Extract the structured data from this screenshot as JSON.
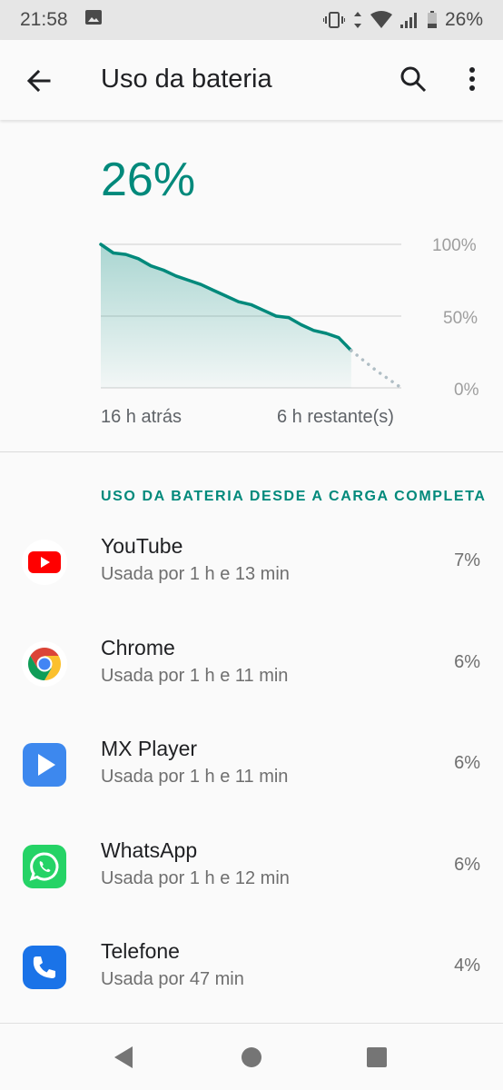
{
  "status_bar": {
    "time": "21:58",
    "battery_text": "26%",
    "icons": [
      "image-icon",
      "vibrate-icon",
      "data-arrows-icon",
      "wifi-icon",
      "signal-icon",
      "battery-icon"
    ]
  },
  "app_bar": {
    "title": "Uso da bateria",
    "back_icon": "arrow-back-icon",
    "search_icon": "search-icon",
    "more_icon": "more-vert-icon"
  },
  "battery": {
    "level": "26%",
    "accent_color": "#00897b"
  },
  "chart_data": {
    "type": "area",
    "y_tick_labels": [
      "100%",
      "50%",
      "0%"
    ],
    "x_labels": {
      "start": "16 h atrás",
      "end": "6 h restante(s)"
    },
    "ylim": [
      0,
      100
    ],
    "series": [
      {
        "values": [
          100,
          94,
          93,
          90,
          85,
          82,
          78,
          75,
          72,
          68,
          64,
          60,
          58,
          54,
          50,
          49,
          44,
          40,
          38,
          35,
          26
        ],
        "style": "solid"
      },
      {
        "values": [
          26,
          19,
          12,
          6,
          0
        ],
        "style": "dotted"
      }
    ]
  },
  "section": {
    "title": "USO DA BATERIA DESDE A CARGA COMPLETA"
  },
  "apps": [
    {
      "name": "YouTube",
      "usage": "Usada por 1 h e 13 min",
      "percent": "7%",
      "icon": "youtube-icon"
    },
    {
      "name": "Chrome",
      "usage": "Usada por 1 h e 11 min",
      "percent": "6%",
      "icon": "chrome-icon"
    },
    {
      "name": "MX Player",
      "usage": "Usada por 1 h e 11 min",
      "percent": "6%",
      "icon": "mx-player-icon"
    },
    {
      "name": "WhatsApp",
      "usage": "Usada por 1 h e 12 min",
      "percent": "6%",
      "icon": "whatsapp-icon"
    },
    {
      "name": "Telefone",
      "usage": "Usada por 47 min",
      "percent": "4%",
      "icon": "phone-icon"
    }
  ]
}
